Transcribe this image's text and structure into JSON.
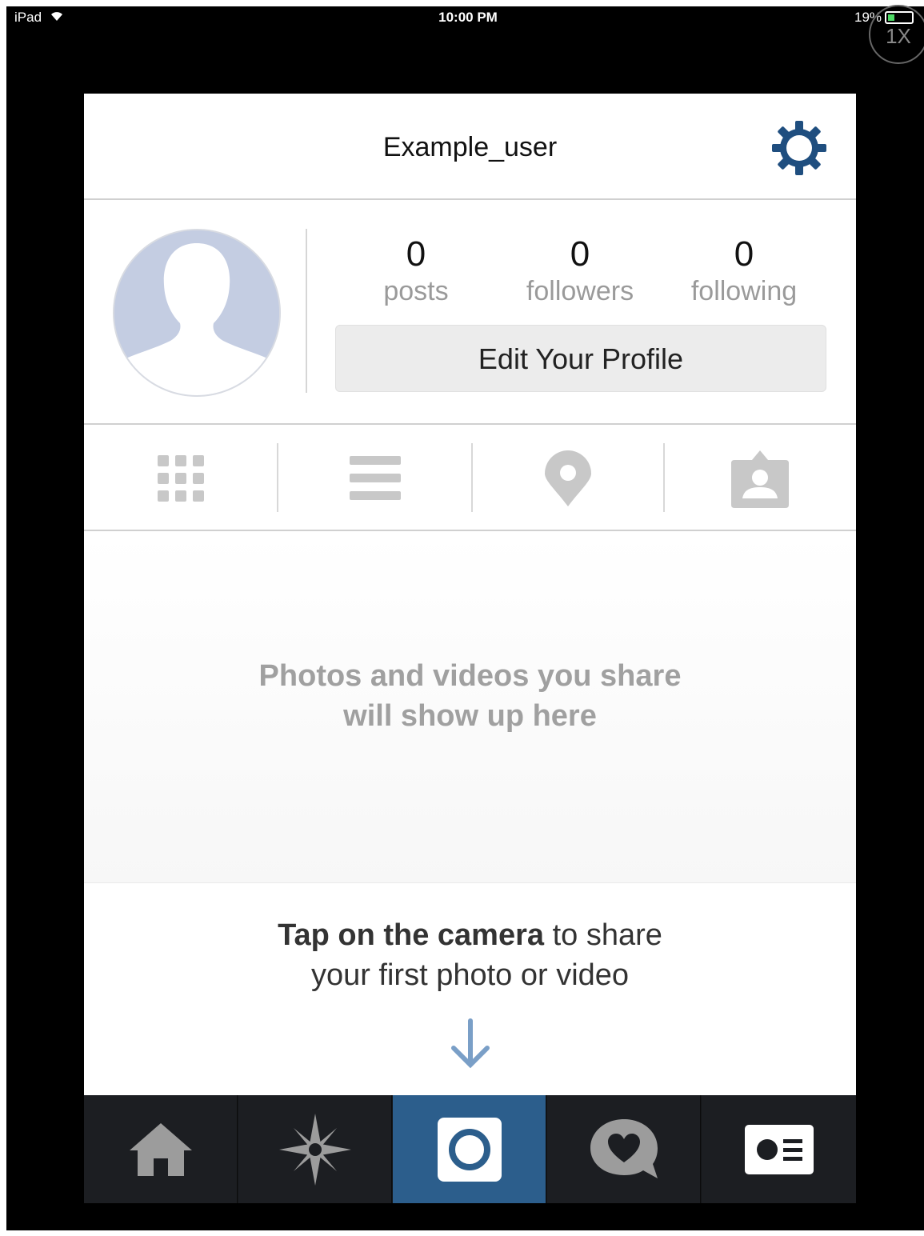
{
  "status_bar": {
    "carrier": "iPad",
    "time": "10:00 PM",
    "battery": "19%",
    "zoom": "1X"
  },
  "nav": {
    "username": "Example_user",
    "settings_icon": "gear-icon"
  },
  "profile": {
    "avatar_icon": "user-silhouette-icon",
    "stats": [
      {
        "value": "0",
        "label": "posts"
      },
      {
        "value": "0",
        "label": "followers"
      },
      {
        "value": "0",
        "label": "following"
      }
    ],
    "edit_button": "Edit Your Profile"
  },
  "view_tabs": [
    {
      "icon": "grid-icon"
    },
    {
      "icon": "list-icon"
    },
    {
      "icon": "map-pin-icon"
    },
    {
      "icon": "tagged-user-icon"
    }
  ],
  "empty_state": {
    "line1": "Photos and videos you share",
    "line2": "will show up here"
  },
  "prompt": {
    "bold": "Tap on the camera",
    "rest": " to share",
    "line2": "your first photo or video"
  },
  "tab_bar": {
    "items": [
      {
        "icon": "home-icon"
      },
      {
        "icon": "explore-icon"
      },
      {
        "icon": "camera-icon",
        "active": true
      },
      {
        "icon": "activity-icon"
      },
      {
        "icon": "profile-card-icon"
      }
    ]
  },
  "colors": {
    "accent": "#2c5e8c",
    "gear": "#1f4e7f",
    "tab_bar_bg": "#1c1e22",
    "avatar": "#c4cde2"
  }
}
